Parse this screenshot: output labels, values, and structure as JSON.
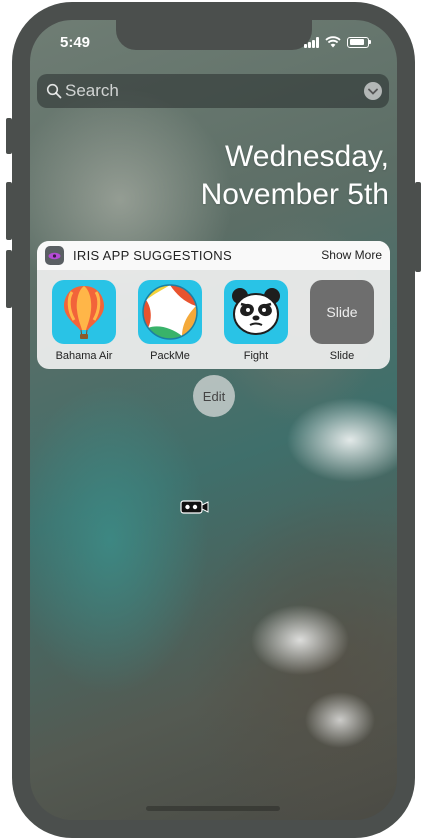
{
  "status_bar": {
    "time": "5:49"
  },
  "search": {
    "placeholder": "Search"
  },
  "date": {
    "line1": "Wednesday,",
    "line2": "November 5th"
  },
  "widget": {
    "title": "IRIS APP SUGGESTIONS",
    "show_more": "Show More",
    "apps": [
      {
        "label": "Bahama Air",
        "icon": "hot-air-balloon-icon"
      },
      {
        "label": "PackMe",
        "icon": "beach-ball-icon"
      },
      {
        "label": "Fight",
        "icon": "panda-icon"
      },
      {
        "label": "Slide",
        "tile_text": "Slide"
      }
    ]
  },
  "edit_label": "Edit",
  "colors": {
    "app_blue": "#29c3e6",
    "slide_gray": "#6e6e6e"
  }
}
